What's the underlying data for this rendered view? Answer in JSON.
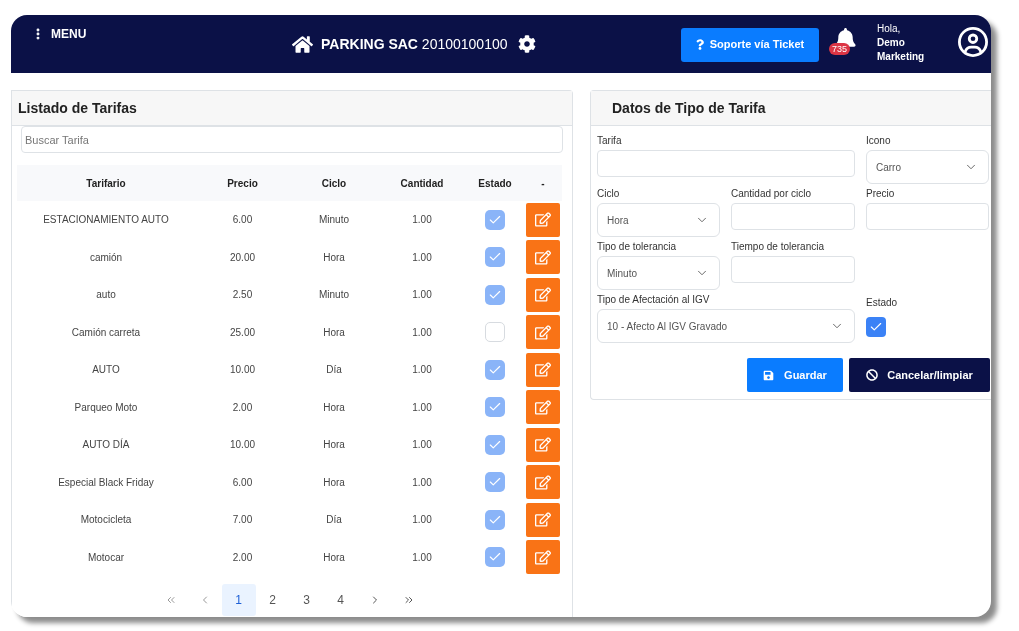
{
  "header": {
    "menu_label": "MENU",
    "title": "**PARKING SAC** 20100100100",
    "support_button": "Soporte vía Ticket",
    "notifications": "735",
    "greeting": "Hola,",
    "user_name": "Demo Marketing"
  },
  "list": {
    "title": "Listado de Tarifas",
    "search": {
      "placeholder": "Buscar Tarifa"
    },
    "columns": [
      "Tarifario",
      "Precio",
      "Ciclo",
      "Cantidad",
      "Estado",
      "-"
    ],
    "rows": [
      {
        "name": "ESTACIONAMIENTO AUTO",
        "price": "6.00",
        "cycle": "Minuto",
        "quantity": "1.00",
        "active": true
      },
      {
        "name": "camión",
        "price": "20.00",
        "cycle": "Hora",
        "quantity": "1.00",
        "active": true
      },
      {
        "name": "auto",
        "price": "2.50",
        "cycle": "Minuto",
        "quantity": "1.00",
        "active": true
      },
      {
        "name": "Camión carreta",
        "price": "25.00",
        "cycle": "Hora",
        "quantity": "1.00",
        "active": false
      },
      {
        "name": "AUTO",
        "price": "10.00",
        "cycle": "Día",
        "quantity": "1.00",
        "active": true
      },
      {
        "name": "Parqueo Moto",
        "price": "2.00",
        "cycle": "Hora",
        "quantity": "1.00",
        "active": true
      },
      {
        "name": "AUTO DÍA",
        "price": "10.00",
        "cycle": "Hora",
        "quantity": "1.00",
        "active": true
      },
      {
        "name": "Especial Black Friday",
        "price": "6.00",
        "cycle": "Hora",
        "quantity": "1.00",
        "active": true
      },
      {
        "name": "Motocicleta",
        "price": "7.00",
        "cycle": "Día",
        "quantity": "1.00",
        "active": true
      },
      {
        "name": "Motocar",
        "price": "2.00",
        "cycle": "Hora",
        "quantity": "1.00",
        "active": true
      }
    ],
    "pagination": {
      "pages": [
        {
          "label": "1",
          "selected": true
        },
        {
          "label": "2",
          "selected": false
        },
        {
          "label": "3",
          "selected": false
        },
        {
          "label": "4",
          "selected": false
        }
      ]
    }
  },
  "form": {
    "title": "Datos de Tipo de Tarifa",
    "fields": [
      {
        "kind": "text",
        "label": "Tarifa"
      },
      {
        "kind": "select",
        "label": "Icono",
        "value": "Carro"
      },
      {
        "kind": "select",
        "label": "Ciclo",
        "value": "Hora"
      },
      {
        "kind": "text",
        "label": "Cantidad por ciclo"
      },
      {
        "kind": "text",
        "label": "Precio"
      },
      {
        "kind": "select",
        "label": "Tipo de tolerancia",
        "value": "Minuto"
      },
      {
        "kind": "text",
        "label": "Tiempo de tolerancia"
      },
      {
        "kind": "select",
        "label": "Tipo de Afectación al IGV",
        "value": "10 - Afecto Al IGV Gravado"
      },
      {
        "kind": "checkbox",
        "label": "Estado",
        "checked": true
      }
    ],
    "buttons": [
      {
        "kind": "save",
        "label": "Guardar"
      },
      {
        "kind": "cancel",
        "label": "Cancelar/limpiar"
      }
    ]
  }
}
